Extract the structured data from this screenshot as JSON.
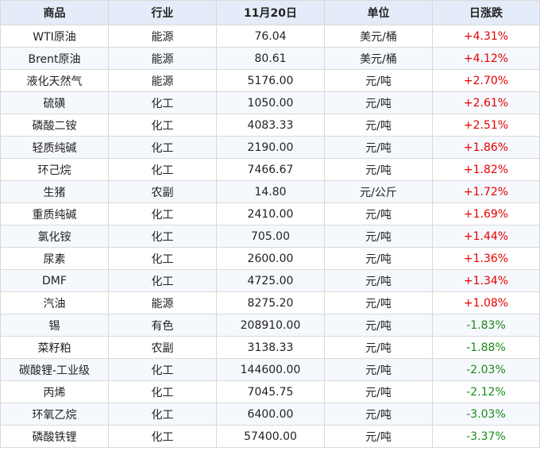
{
  "table": {
    "headers": [
      "商品",
      "行业",
      "11月20日",
      "单位",
      "日涨跌"
    ],
    "rows": [
      [
        "WTI原油",
        "能源",
        "76.04",
        "美元/桶",
        "+4.31%"
      ],
      [
        "Brent原油",
        "能源",
        "80.61",
        "美元/桶",
        "+4.12%"
      ],
      [
        "液化天然气",
        "能源",
        "5176.00",
        "元/吨",
        "+2.70%"
      ],
      [
        "硫磺",
        "化工",
        "1050.00",
        "元/吨",
        "+2.61%"
      ],
      [
        "磷酸二铵",
        "化工",
        "4083.33",
        "元/吨",
        "+2.51%"
      ],
      [
        "轻质纯碱",
        "化工",
        "2190.00",
        "元/吨",
        "+1.86%"
      ],
      [
        "环己烷",
        "化工",
        "7466.67",
        "元/吨",
        "+1.82%"
      ],
      [
        "生猪",
        "农副",
        "14.80",
        "元/公斤",
        "+1.72%"
      ],
      [
        "重质纯碱",
        "化工",
        "2410.00",
        "元/吨",
        "+1.69%"
      ],
      [
        "氯化铵",
        "化工",
        "705.00",
        "元/吨",
        "+1.44%"
      ],
      [
        "尿素",
        "化工",
        "2600.00",
        "元/吨",
        "+1.36%"
      ],
      [
        "DMF",
        "化工",
        "4725.00",
        "元/吨",
        "+1.34%"
      ],
      [
        "汽油",
        "能源",
        "8275.20",
        "元/吨",
        "+1.08%"
      ],
      [
        "锡",
        "有色",
        "208910.00",
        "元/吨",
        "-1.83%"
      ],
      [
        "菜籽粕",
        "农副",
        "3138.33",
        "元/吨",
        "-1.88%"
      ],
      [
        "碳酸锂-工业级",
        "化工",
        "144600.00",
        "元/吨",
        "-2.03%"
      ],
      [
        "丙烯",
        "化工",
        "7045.75",
        "元/吨",
        "-2.12%"
      ],
      [
        "环氧乙烷",
        "化工",
        "6400.00",
        "元/吨",
        "-3.03%"
      ],
      [
        "磷酸铁锂",
        "化工",
        "57400.00",
        "元/吨",
        "-3.37%"
      ]
    ]
  },
  "colors": {
    "up": "#e60000",
    "down": "#1a8a1a",
    "header_bg": "#e3ecf8"
  }
}
